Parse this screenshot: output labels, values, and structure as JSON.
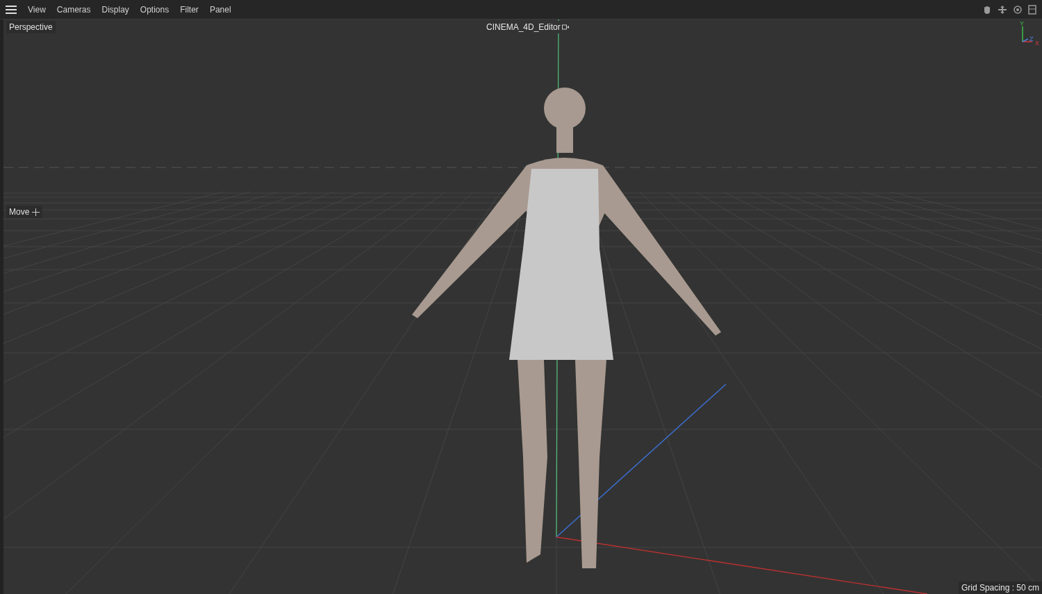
{
  "menu": [
    {
      "label": "View"
    },
    {
      "label": "Cameras"
    },
    {
      "label": "Display"
    },
    {
      "label": "Options"
    },
    {
      "label": "Filter"
    },
    {
      "label": "Panel"
    }
  ],
  "viewport": {
    "name": "Perspective",
    "camera": "CINEMA_4D_Editor",
    "tool": "Move",
    "grid_spacing": "Grid Spacing : 50 cm",
    "axes": [
      {
        "label": "Y"
      },
      {
        "label": "Z"
      },
      {
        "label": "X"
      }
    ]
  }
}
